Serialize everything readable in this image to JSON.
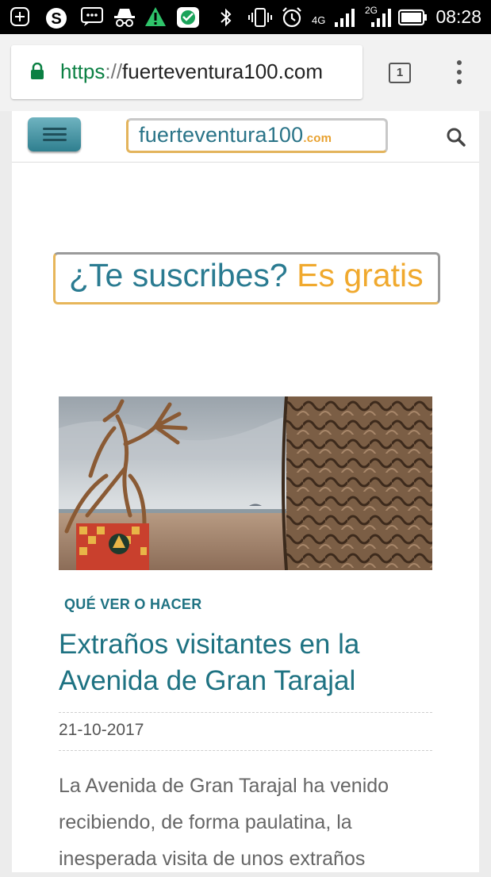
{
  "status_bar": {
    "time": "08:28",
    "network_1": "4G",
    "network_2": "2G",
    "icons": [
      "add-icon",
      "skype-icon",
      "messenger-icon",
      "incognito-icon",
      "warning-icon",
      "wifi-app-icon",
      "bluetooth-icon",
      "vibrate-icon",
      "alarm-icon",
      "signal-icon",
      "signal-icon",
      "battery-icon"
    ]
  },
  "browser": {
    "url_scheme": "https",
    "url_separator": "://",
    "url_host": "fuerteventura100.com",
    "tab_count": "1"
  },
  "site": {
    "logo_name": "fuerteventura100",
    "logo_tld": ".com"
  },
  "banner": {
    "question": "¿Te suscribes?",
    "free": "Es gratis"
  },
  "article": {
    "category": "QUÉ VER O HACER",
    "title": "Extraños visitantes en la Avenida de Gran Tarajal",
    "date": "21-10-2017",
    "excerpt": "La Avenida de Gran Tarajal ha venido recibiendo, de forma paulatina, la inesperada visita de unos extraños"
  },
  "colors": {
    "accent": "#1e7282",
    "logo_blue": "#2a7488",
    "logo_orange": "#e8a12f",
    "secure_green": "#0b8043"
  }
}
